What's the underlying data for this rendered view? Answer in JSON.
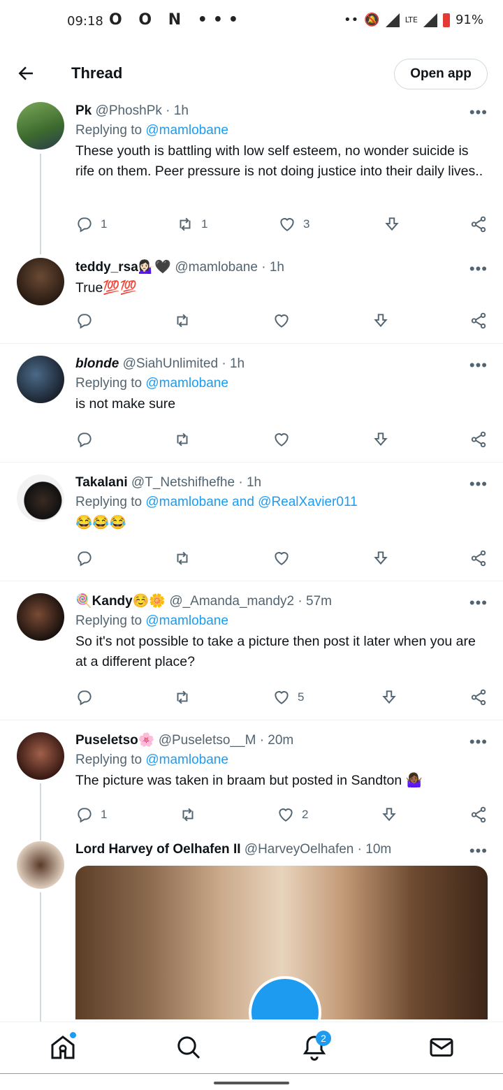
{
  "status": {
    "time": "09:18",
    "left": "O O N •••",
    "right_dots": "••",
    "network": "LTE",
    "battery": "91%"
  },
  "header": {
    "title": "Thread",
    "open_app": "Open app"
  },
  "tweets": [
    {
      "name": "Pk",
      "handle": "@PhoshPk",
      "time": "· 1h",
      "reply_prefix": "Replying to",
      "reply_to": "@mamlobane",
      "text": "These youth is battling with low self esteem, no wonder suicide is rife on them. Peer pressure is not doing justice into their daily lives..",
      "replies": "1",
      "retweets": "1",
      "likes": "3"
    },
    {
      "name": "teddy_rsa💁🏻‍♀️🖤",
      "handle": "@mamlobane",
      "time": "· 1h",
      "text": "True💯💯",
      "replies": "",
      "retweets": "",
      "likes": ""
    },
    {
      "name": "blonde",
      "handle": "@SiahUnlimited",
      "time": "· 1h",
      "reply_prefix": "Replying to",
      "reply_to": "@mamlobane",
      "text": "is not make sure",
      "replies": "",
      "retweets": "",
      "likes": ""
    },
    {
      "name": "Takalani",
      "handle": "@T_Netshifhefhe",
      "time": "· 1h",
      "reply_prefix": "Replying to",
      "reply_to": "@mamlobane and @RealXavier011",
      "text": "😂😂😂",
      "replies": "",
      "retweets": "",
      "likes": ""
    },
    {
      "name": "🍭Kandy☺️🌼",
      "handle": "@_Amanda_mandy2",
      "time": "· 57m",
      "reply_prefix": "Replying to",
      "reply_to": "@mamlobane",
      "text": "So it's not possible to take a picture then post it later when you are at a different place?",
      "replies": "",
      "retweets": "",
      "likes": "5"
    },
    {
      "name": "Puseletso🌸",
      "handle": "@Puseletso__M",
      "time": "· 20m",
      "reply_prefix": "Replying to",
      "reply_to": "@mamlobane",
      "text": "The picture was taken in braam but posted in Sandton 🤷🏾‍♀️",
      "replies": "1",
      "retweets": "",
      "likes": "2"
    },
    {
      "name": "Lord Harvey of Oelhafen II",
      "handle": "@HarveyOelhafen",
      "time": "· 10m"
    }
  ],
  "more_label": "•••",
  "nav": {
    "notifications_badge": "2"
  }
}
